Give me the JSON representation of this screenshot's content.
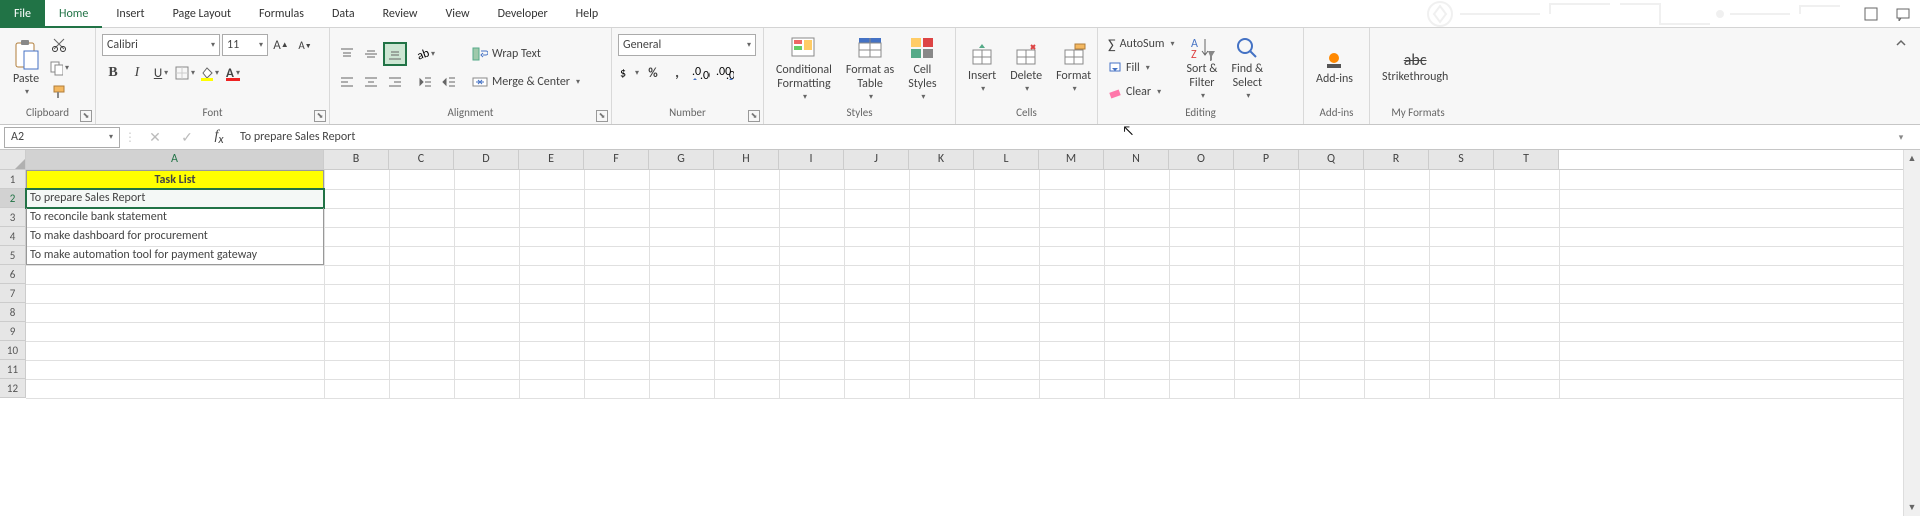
{
  "tabs": {
    "file": "File",
    "home": "Home",
    "insert": "Insert",
    "page": "Page Layout",
    "formulas": "Formulas",
    "data": "Data",
    "review": "Review",
    "view": "View",
    "dev": "Developer",
    "help": "Help"
  },
  "clipboard": {
    "paste": "Paste",
    "label": "Clipboard"
  },
  "font": {
    "name": "Calibri",
    "size": "11",
    "label": "Font"
  },
  "alignment": {
    "wrap": "Wrap Text",
    "merge": "Merge & Center",
    "label": "Alignment"
  },
  "number": {
    "format": "General",
    "label": "Number"
  },
  "styles": {
    "cond": "Conditional\nFormatting",
    "fat": "Format as\nTable",
    "cell": "Cell\nStyles",
    "label": "Styles"
  },
  "cellsg": {
    "insert": "Insert",
    "delete": "Delete",
    "format": "Format",
    "label": "Cells"
  },
  "editing": {
    "autosum": "AutoSum",
    "fill": "Fill",
    "clear": "Clear",
    "sort": "Sort &\nFilter",
    "find": "Find &\nSelect",
    "label": "Editing"
  },
  "addins": {
    "btn": "Add-ins",
    "label": "Add-ins"
  },
  "myfmt": {
    "btn": "Strikethrough",
    "label": "My Formats"
  },
  "namebox": "A2",
  "formula": "To prepare Sales Report",
  "cols": [
    "A",
    "B",
    "C",
    "D",
    "E",
    "F",
    "G",
    "H",
    "I",
    "J",
    "K",
    "L",
    "M",
    "N",
    "O",
    "P",
    "Q",
    "R",
    "S",
    "T"
  ],
  "colW": {
    "A": 298,
    "def": 65
  },
  "rows": [
    1,
    2,
    3,
    4,
    5,
    6,
    7,
    8,
    9,
    10,
    11,
    12
  ],
  "cells": {
    "A1": "Task List",
    "A2": "To prepare Sales Report",
    "A3": "To reconcile bank statement",
    "A4": "To make dashboard for procurement",
    "A5": "To make automation tool for payment gateway"
  },
  "active": "A2"
}
